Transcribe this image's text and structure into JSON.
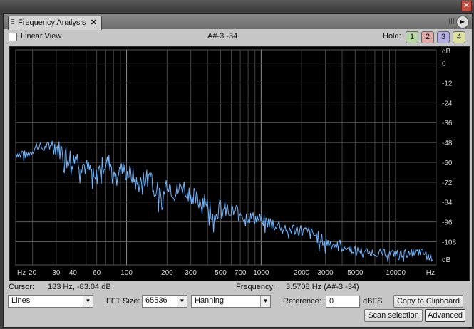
{
  "window": {
    "close_glyph": "✕"
  },
  "tab": {
    "label": "Frequency Analysis",
    "close_glyph": "✕",
    "menu_glyph": "▶"
  },
  "toolbar": {
    "linear_view_label": "Linear View",
    "linear_view_checked": false,
    "note": "A#-3 -34",
    "hold_label": "Hold:",
    "hold_buttons": [
      {
        "label": "1",
        "color": "#b6d6a6"
      },
      {
        "label": "2",
        "color": "#e2aaa6"
      },
      {
        "label": "3",
        "color": "#b3aee3"
      },
      {
        "label": "4",
        "color": "#dfe0a0"
      }
    ]
  },
  "axis": {
    "db_unit": "dB",
    "db_ticks": [
      "0",
      "-12",
      "-24",
      "-36",
      "-48",
      "-60",
      "-72",
      "-84",
      "-96",
      "-108"
    ],
    "hz_unit": "Hz",
    "hz_ticks": [
      "20",
      "30",
      "40",
      "60",
      "100",
      "200",
      "300",
      "500",
      "700",
      "1000",
      "2000",
      "3000",
      "5000",
      "10000"
    ]
  },
  "chart_data": {
    "type": "line",
    "xlabel": "Hz",
    "ylabel": "dB",
    "x_scale": "log",
    "xlim": [
      15,
      20000
    ],
    "ylim": [
      -122,
      8
    ],
    "grid": true,
    "line_color": "#6fb6ff",
    "series": [
      {
        "values": [
          [
            15,
            -55
          ],
          [
            17,
            -54
          ],
          [
            18,
            -56
          ],
          [
            20,
            -53
          ],
          [
            22,
            -49
          ],
          [
            24,
            -52
          ],
          [
            26,
            -50
          ],
          [
            28,
            -48
          ],
          [
            31,
            -52
          ],
          [
            34,
            -53
          ],
          [
            37,
            -57
          ],
          [
            41,
            -55
          ],
          [
            45,
            -60
          ],
          [
            50,
            -63
          ],
          [
            55,
            -66
          ],
          [
            58,
            -72
          ],
          [
            62,
            -65
          ],
          [
            68,
            -61
          ],
          [
            75,
            -60
          ],
          [
            82,
            -66
          ],
          [
            90,
            -63
          ],
          [
            100,
            -66
          ],
          [
            110,
            -68
          ],
          [
            120,
            -74
          ],
          [
            135,
            -70
          ],
          [
            150,
            -66
          ],
          [
            165,
            -75
          ],
          [
            183,
            -83
          ],
          [
            200,
            -71
          ],
          [
            230,
            -79
          ],
          [
            260,
            -74
          ],
          [
            300,
            -79
          ],
          [
            340,
            -84
          ],
          [
            380,
            -81
          ],
          [
            430,
            -89
          ],
          [
            500,
            -88
          ],
          [
            580,
            -90
          ],
          [
            680,
            -90
          ],
          [
            800,
            -93
          ],
          [
            950,
            -94
          ],
          [
            1100,
            -96
          ],
          [
            1300,
            -97
          ],
          [
            1600,
            -100
          ],
          [
            2000,
            -101
          ],
          [
            2500,
            -104
          ],
          [
            3000,
            -108
          ],
          [
            3800,
            -110
          ],
          [
            5000,
            -113
          ],
          [
            6500,
            -114
          ],
          [
            8000,
            -115
          ],
          [
            10000,
            -115
          ],
          [
            12500,
            -115
          ],
          [
            15000,
            -114
          ],
          [
            17500,
            -116
          ],
          [
            19000,
            -118
          ]
        ]
      }
    ]
  },
  "status": {
    "cursor_label": "Cursor:",
    "cursor_value": "183 Hz, -83.04 dB",
    "frequency_label": "Frequency:",
    "frequency_value": "3.5708 Hz (A#-3 -34)"
  },
  "controls": {
    "view_mode": "Lines",
    "fft_label": "FFT Size:",
    "fft_size": "65536",
    "window_fn": "Hanning",
    "reference_label": "Reference:",
    "reference_value": "0",
    "reference_unit": "dBFS",
    "copy_label": "Copy to Clipboard",
    "scan_label": "Scan selection",
    "advanced_label": "Advanced"
  }
}
